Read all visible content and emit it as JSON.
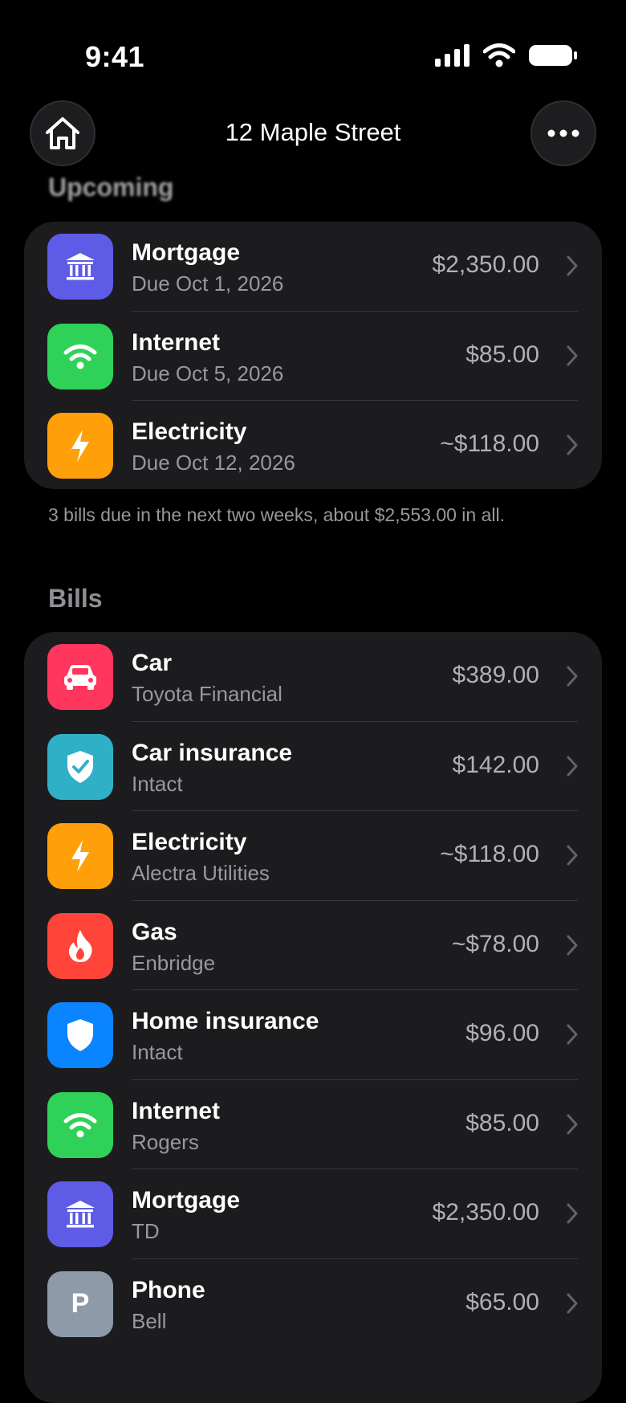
{
  "status": {
    "time": "9:41"
  },
  "nav": {
    "title": "12 Maple Street"
  },
  "upcoming": {
    "header": "Upcoming",
    "items": [
      {
        "title": "Mortgage",
        "subtitle": "Due Oct 1, 2026",
        "amount": "$2,350.00",
        "icon": "bank-icon",
        "color": "#5e5ce6"
      },
      {
        "title": "Internet",
        "subtitle": "Due Oct 5, 2026",
        "amount": "$85.00",
        "icon": "wifi-icon",
        "color": "#30d158"
      },
      {
        "title": "Electricity",
        "subtitle": "Due Oct 12, 2026",
        "amount": "~$118.00",
        "icon": "bolt-icon",
        "color": "#ff9f0a"
      }
    ],
    "footnote": "3 bills due in the next two weeks, about $2,553.00 in all."
  },
  "bills": {
    "header": "Bills",
    "items": [
      {
        "title": "Car",
        "subtitle": "Toyota Financial",
        "amount": "$389.00",
        "icon": "car-icon",
        "color": "#ff375f"
      },
      {
        "title": "Car insurance",
        "subtitle": "Intact",
        "amount": "$142.00",
        "icon": "shield-check-icon",
        "color": "#30b0c7"
      },
      {
        "title": "Electricity",
        "subtitle": "Alectra Utilities",
        "amount": "~$118.00",
        "icon": "bolt-icon",
        "color": "#ff9f0a"
      },
      {
        "title": "Gas",
        "subtitle": "Enbridge",
        "amount": "~$78.00",
        "icon": "flame-icon",
        "color": "#ff453a"
      },
      {
        "title": "Home insurance",
        "subtitle": "Intact",
        "amount": "$96.00",
        "icon": "shield-icon",
        "color": "#0a84ff"
      },
      {
        "title": "Internet",
        "subtitle": "Rogers",
        "amount": "$85.00",
        "icon": "wifi-icon",
        "color": "#30d158"
      },
      {
        "title": "Mortgage",
        "subtitle": "TD",
        "amount": "$2,350.00",
        "icon": "bank-icon",
        "color": "#5e5ce6"
      },
      {
        "title": "Phone",
        "subtitle": "Bell",
        "amount": "$65.00",
        "icon": "letter-p-icon",
        "icon_text": "P",
        "color": "#8e9aa8"
      }
    ]
  }
}
